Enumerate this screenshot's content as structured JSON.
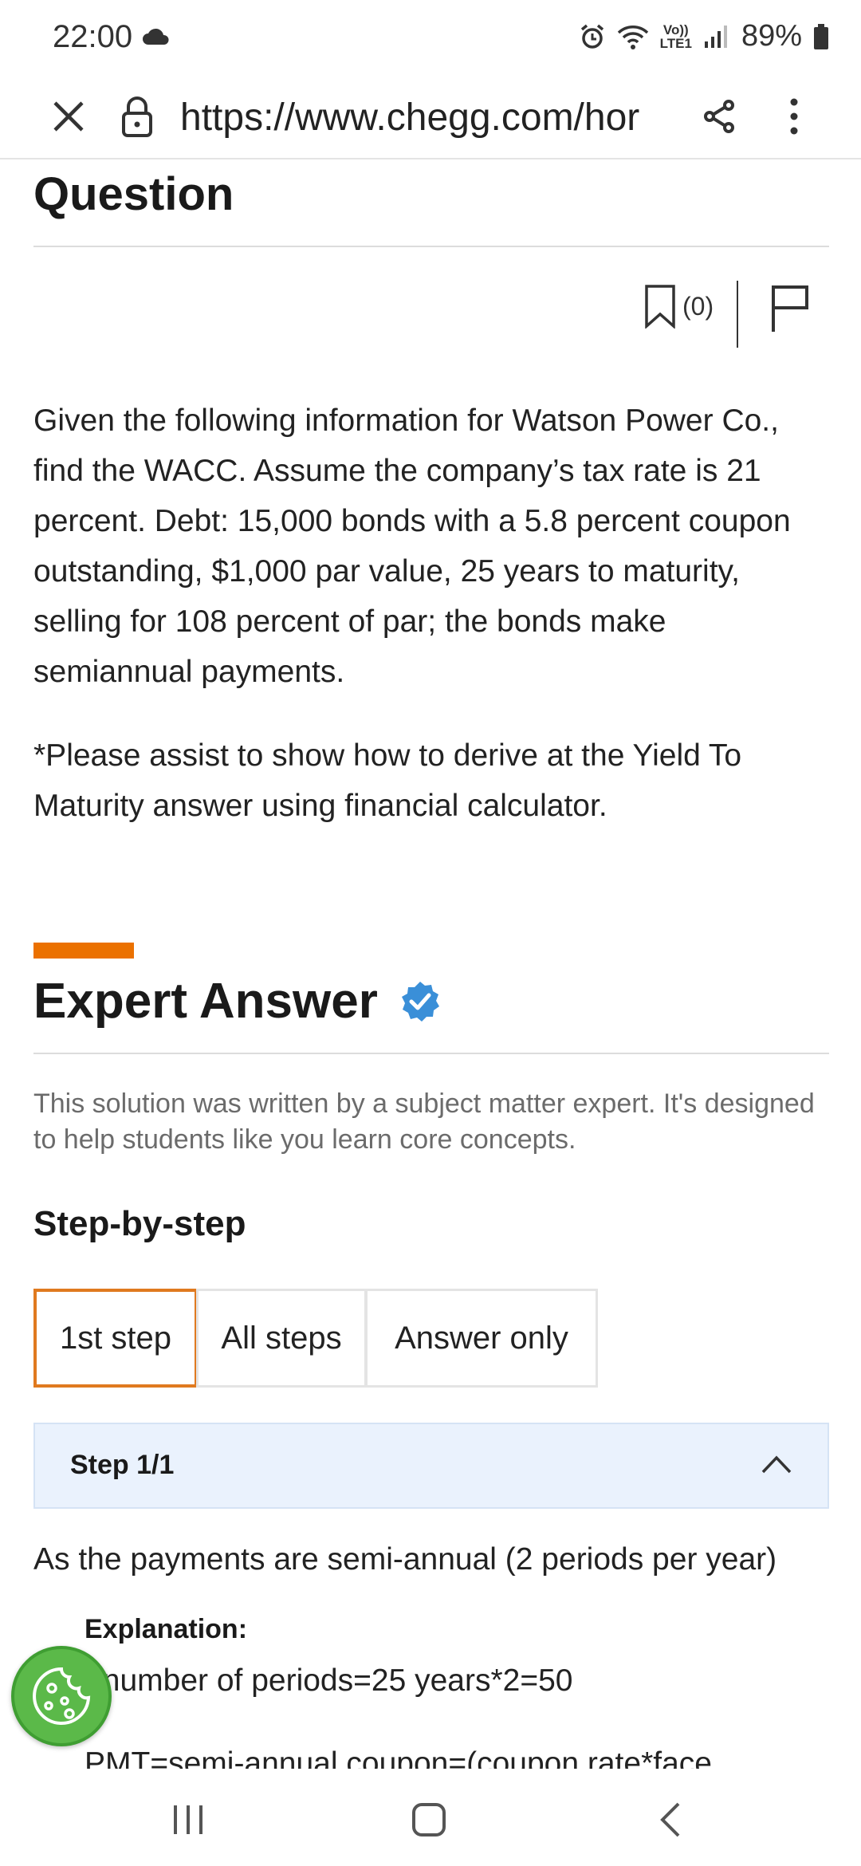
{
  "status": {
    "time": "22:00",
    "network_label_top": "Vo))",
    "network_label_bottom": "LTE1",
    "battery": "89%"
  },
  "browser": {
    "url": "https://www.chegg.com/hor"
  },
  "question": {
    "title": "Question",
    "bookmark_count": "(0)",
    "body": "Given the following information for Watson Power Co., find the WACC. Assume the company’s tax rate is 21 percent. Debt: 15,000 bonds with a 5.8 percent coupon outstanding, $1,000 par value, 25 years to maturity, selling for 108 percent of par; the bonds make semiannual payments.",
    "note": "*Please assist to show how to derive at the Yield To Maturity answer using financial calculator."
  },
  "expert": {
    "title": "Expert Answer",
    "note": "This solution was written by a subject matter expert. It's designed to help students like you learn core concepts.",
    "step_heading": "Step-by-step",
    "tabs": [
      {
        "label": "1st step"
      },
      {
        "label": "All steps"
      },
      {
        "label": "Answer only"
      }
    ],
    "step_label": "Step 1/1",
    "step_text": "As the payments are semi-annual (2 periods per year)",
    "explanation_label": "Explanation:",
    "explanation_line1": "=number of periods=25 years*2=50",
    "explanation_line2": "PMT=semi-annual coupon=(coupon rate*face"
  },
  "colors": {
    "accent_orange": "#eb7100",
    "verified_blue": "#3a8fd8",
    "cookie_green": "#5bb949"
  }
}
